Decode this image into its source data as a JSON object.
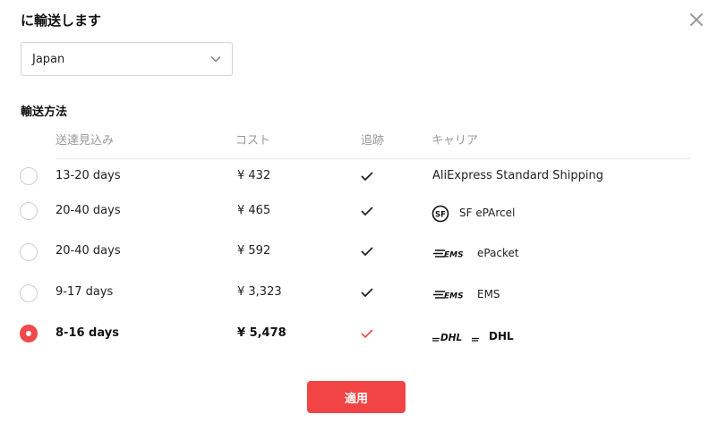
{
  "dialog": {
    "title": "に輸送します",
    "close_icon": "close-icon"
  },
  "country_select": {
    "value": "Japan",
    "chevron_icon": "chevron-down-icon"
  },
  "shipping": {
    "section_title": "輸送方法",
    "columns": {
      "delivery": "送達見込み",
      "cost": "コスト",
      "tracking": "追跡",
      "carrier": "キャリア"
    },
    "rows": [
      {
        "delivery": "13-20 days",
        "cost": "¥ 432",
        "tracking": true,
        "carrier": "AliExpress Standard Shipping",
        "logo": "",
        "selected": false
      },
      {
        "delivery": "20-40 days",
        "cost": "¥ 465",
        "tracking": true,
        "carrier": "SF ePArcel",
        "logo": "sf-logo-icon",
        "selected": false
      },
      {
        "delivery": "20-40 days",
        "cost": "¥ 592",
        "tracking": true,
        "carrier": "ePacket",
        "logo": "ems-logo-icon",
        "selected": false
      },
      {
        "delivery": "9-17 days",
        "cost": "¥ 3,323",
        "tracking": true,
        "carrier": "EMS",
        "logo": "ems-logo-icon",
        "selected": false
      },
      {
        "delivery": "8-16 days",
        "cost": "¥ 5,478",
        "tracking": true,
        "carrier": "DHL",
        "logo": "dhl-logo-icon",
        "selected": true
      }
    ]
  },
  "apply_button": {
    "label": "適用"
  },
  "colors": {
    "accent": "#f24444",
    "selected_check": "#f0494a",
    "header_text": "#999999"
  }
}
